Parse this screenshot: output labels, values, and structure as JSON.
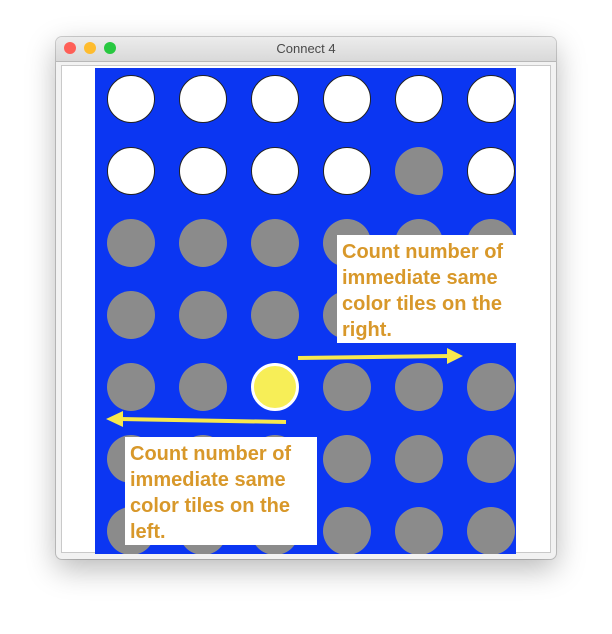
{
  "window": {
    "title": "Connect 4",
    "controls": {
      "close_color": "#fe5f57",
      "minimize_color": "#febc2e",
      "maximize_color": "#28c840"
    }
  },
  "board": {
    "background_color": "#0b36f2",
    "columns": 6,
    "rows_visible": 7,
    "colors": {
      "empty": "#ffffff",
      "filled": "#8b8b8b",
      "selected": "#f7ee57"
    },
    "grid": [
      [
        "empty",
        "empty",
        "empty",
        "empty",
        "empty",
        "empty"
      ],
      [
        "empty",
        "empty",
        "empty",
        "empty",
        "filled",
        "empty"
      ],
      [
        "filled",
        "filled",
        "filled",
        "filled",
        "filled",
        "filled"
      ],
      [
        "filled",
        "filled",
        "filled",
        "filled",
        "filled",
        "filled"
      ],
      [
        "filled",
        "filled",
        "selected",
        "filled",
        "filled",
        "filled"
      ],
      [
        "filled",
        "filled",
        "filled",
        "filled",
        "filled",
        "filled"
      ],
      [
        "filled",
        "filled",
        "filled",
        "filled",
        "filled",
        "filled"
      ]
    ]
  },
  "annotations": {
    "text_color": "#d8982a",
    "arrow_color": "#f7e84d",
    "right_note": "Count number of immediate same color tiles on the right.",
    "left_note": "Count number of immediate same color tiles on the left."
  }
}
